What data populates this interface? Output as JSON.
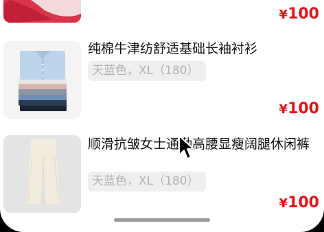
{
  "currency_symbol": "¥",
  "items": [
    {
      "title": "",
      "spec": "",
      "price": "100",
      "thumb_icon": "red-shirt-image"
    },
    {
      "title": "纯棉牛津纺舒适基础长袖衬衫",
      "spec": "天蓝色，XL（180）",
      "price": "100",
      "thumb_icon": "folded-shirts-image"
    },
    {
      "title": "顺滑抗皱女士通勤高腰显瘦阔腿休闲裤",
      "spec": "天蓝色，XL（180）",
      "price": "100",
      "thumb_icon": "wide-leg-pants-image"
    }
  ],
  "colors": {
    "price": "#e3131a",
    "spec_bg": "#efefef",
    "spec_text": "#b3b3b3",
    "bezel": "#000000"
  }
}
